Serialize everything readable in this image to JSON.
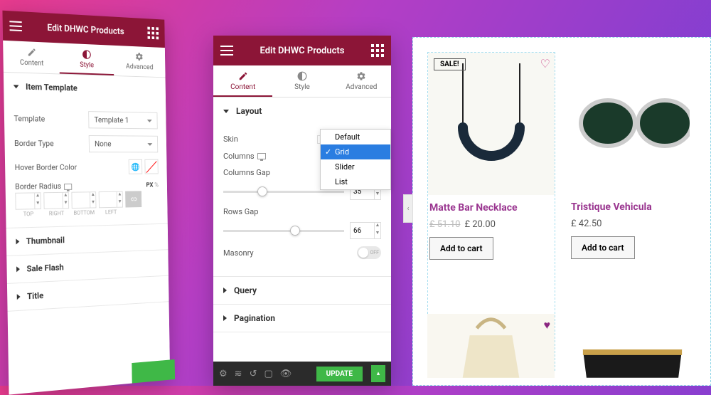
{
  "panel_left": {
    "title": "Edit DHWC Products",
    "tabs": {
      "content": "Content",
      "style": "Style",
      "advanced": "Advanced"
    },
    "section_item_template": "Item Template",
    "template_label": "Template",
    "template_value": "Template 1",
    "border_type_label": "Border Type",
    "border_type_value": "None",
    "hover_border_label": "Hover Border Color",
    "border_radius_label": "Border Radius",
    "units_px": "PX",
    "units_pc": "%",
    "dim_top": "TOP",
    "dim_right": "RIGHT",
    "dim_bottom": "BOTTOM",
    "dim_left": "LEFT",
    "section_thumbnail": "Thumbnail",
    "section_sale": "Sale Flash",
    "section_title": "Title"
  },
  "panel_mid": {
    "title": "Edit DHWC Products",
    "tabs": {
      "content": "Content",
      "style": "Style",
      "advanced": "Advanced"
    },
    "section_layout": "Layout",
    "skin_label": "Skin",
    "skin_options": {
      "default": "Default",
      "grid": "Grid",
      "slider": "Slider",
      "list": "List"
    },
    "columns_label": "Columns",
    "columns_gap_label": "Columns Gap",
    "columns_gap_value": "35",
    "rows_gap_label": "Rows Gap",
    "rows_gap_value": "66",
    "masonry_label": "Masonry",
    "masonry_state": "OFF",
    "section_query": "Query",
    "section_pagination": "Pagination",
    "update": "UPDATE"
  },
  "preview": {
    "badge": "SALE!",
    "p1_name": "Matte Bar Necklace",
    "p1_old": "£ 51.10",
    "p1_price": "£ 20.00",
    "p2_name": "Tristique Vehicula",
    "p2_price": "£ 42.50",
    "cart": "Add to cart"
  }
}
